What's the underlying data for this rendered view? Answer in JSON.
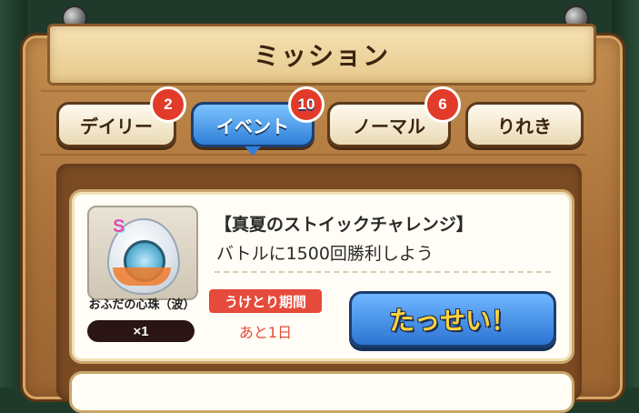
{
  "header": {
    "title": "ミッション"
  },
  "tabs": [
    {
      "label": "デイリー",
      "badge": "2",
      "active": false
    },
    {
      "label": "イベント",
      "badge": "10",
      "active": true
    },
    {
      "label": "ノーマル",
      "badge": "6",
      "active": false
    },
    {
      "label": "りれき",
      "badge": "",
      "active": false
    }
  ],
  "missions": [
    {
      "title": "【真夏のストイックチャレンジ】",
      "description": "バトルに1500回勝利しよう",
      "reward": {
        "rank": "S",
        "name": "おふだの心珠（波）",
        "quantity": "×1",
        "icon": "orb-icon"
      },
      "period_label": "うけとり期間",
      "period_value": "あと1日",
      "action_label": "たっせい！"
    }
  ],
  "colors": {
    "active_tab": "#2f7fd6",
    "badge": "#e23b2a",
    "period": "#e64a3a",
    "button_text": "#ffd23a"
  }
}
